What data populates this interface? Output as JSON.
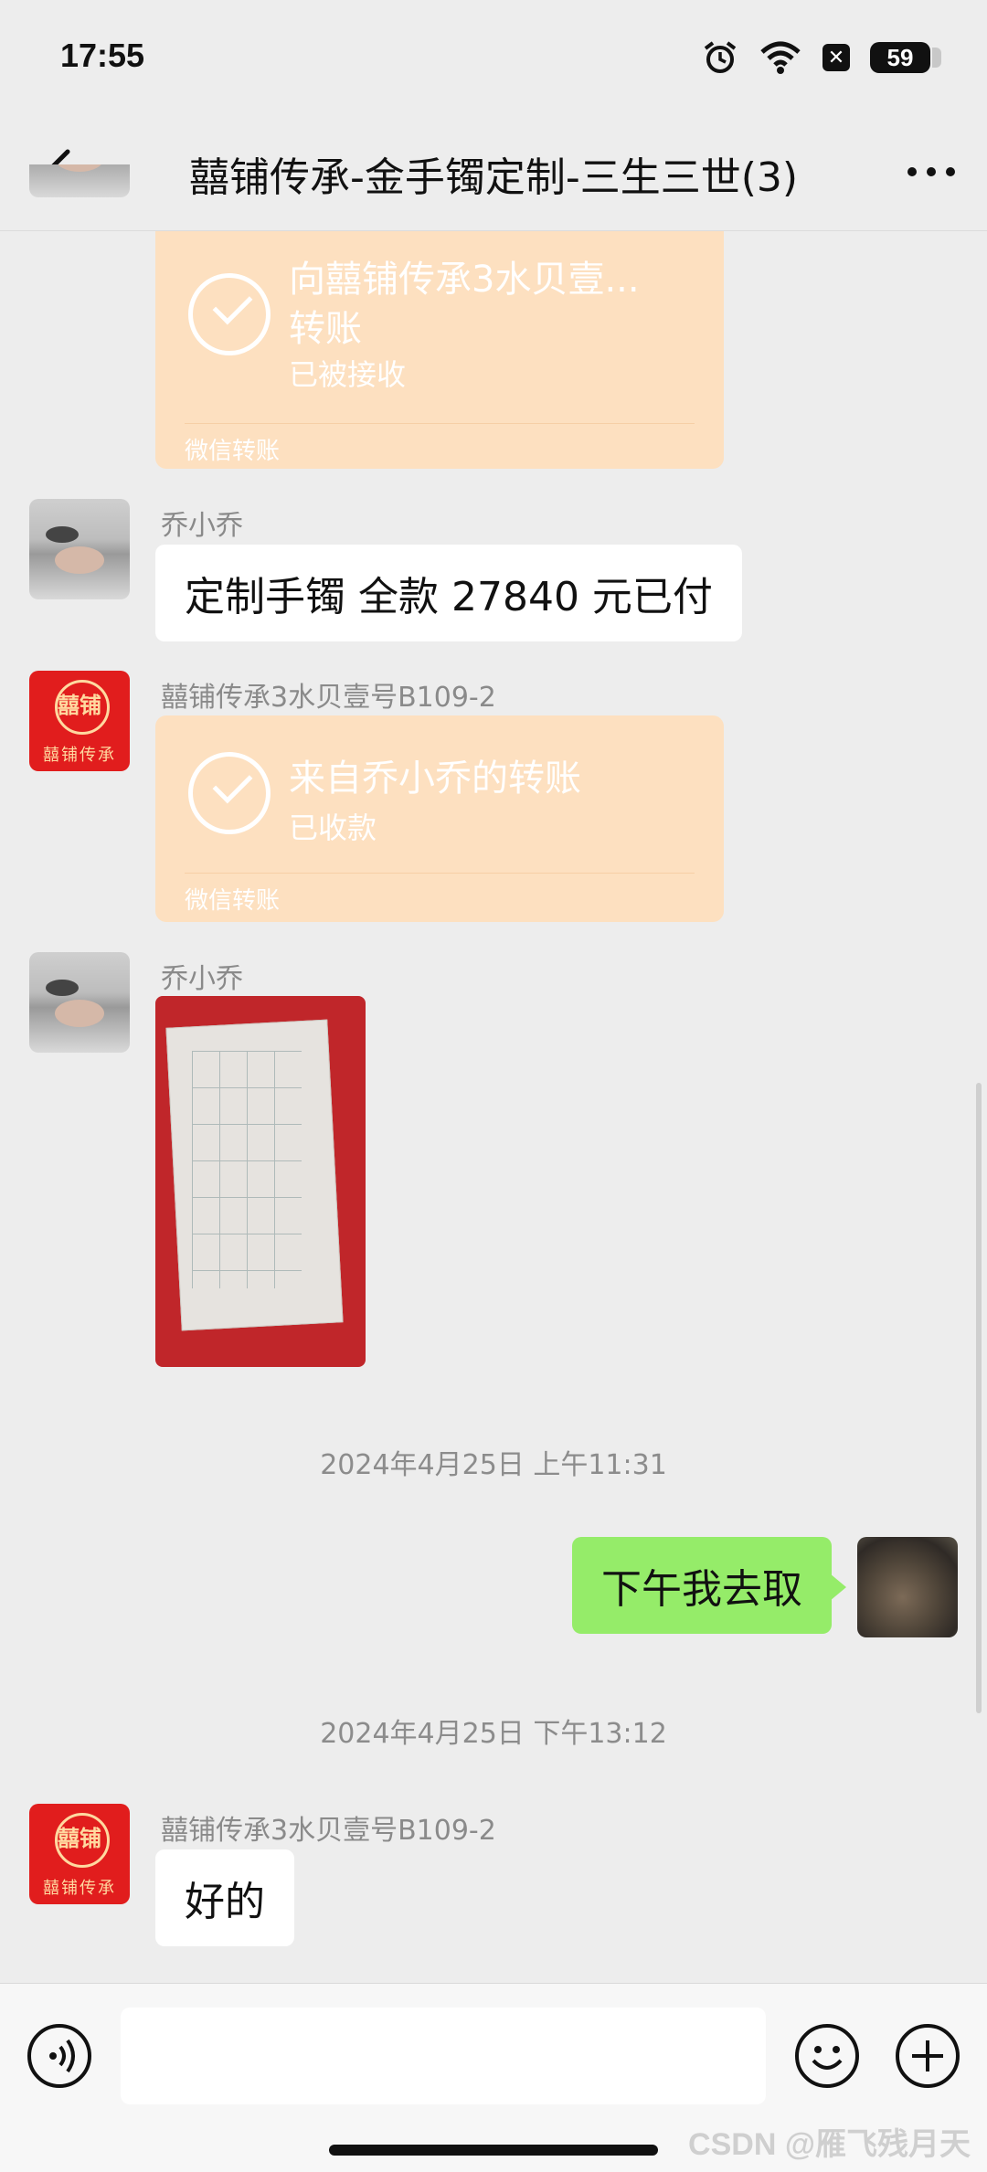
{
  "status_bar": {
    "time": "17:55",
    "battery": "59",
    "icons": [
      "alarm-icon",
      "wifi-icon",
      "x-badge-icon",
      "battery-icon"
    ]
  },
  "nav": {
    "title": "囍铺传承-金手镯定制-三生三世(3)",
    "back_icon": "chevron-left-icon",
    "more_icon": "more-icon"
  },
  "messages": {
    "m1": {
      "title_line1": "向囍铺传承3水贝壹...",
      "title_line2": "转账",
      "status": "已被接收",
      "footer": "微信转账"
    },
    "m2": {
      "sender": "乔小乔",
      "text": "定制手镯 全款 27840 元已付"
    },
    "m3": {
      "sender": "囍铺传承3水贝壹号B109-2",
      "title": "来自乔小乔的转账",
      "status": "已收款",
      "footer": "微信转账"
    },
    "m4": {
      "sender": "乔小乔"
    },
    "ts1": "2024年4月25日 上午11:31",
    "m5": {
      "text": "下午我去取"
    },
    "ts2": "2024年4月25日 下午13:12",
    "m6": {
      "sender": "囍铺传承3水贝壹号B109-2",
      "text": "好的"
    }
  },
  "shop_avatar": {
    "glyph": "囍铺",
    "sub": "囍铺传承"
  },
  "input_bar": {
    "voice_icon": "voice-icon",
    "emoji_icon": "emoji-icon",
    "plus_icon": "plus-icon"
  },
  "watermark": "CSDN @雁飞残月天",
  "colors": {
    "background": "#ededed",
    "transfer_bubble": "#fde0c0",
    "outgoing_bubble": "#95ec69",
    "incoming_bubble": "#ffffff"
  }
}
